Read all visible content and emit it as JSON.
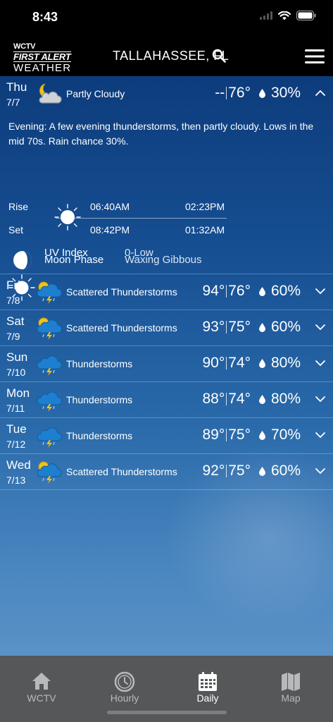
{
  "status": {
    "time": "8:43"
  },
  "header": {
    "logo_top": "WCTV",
    "logo_mid": "FIRST ALERT",
    "logo_bottom": "WEATHER",
    "city": "TALLAHASSEE, FL"
  },
  "today": {
    "day": "Thu",
    "date": "7/7",
    "condition": "Partly Cloudy",
    "high": "--",
    "low": "76°",
    "rain": "30%",
    "narrative_label": "Evening",
    "narrative_text": ": A few evening thunderstorms, then partly cloudy. Lows in the mid 70s. Rain chance 30%.",
    "rise_label": "Rise",
    "set_label": "Set",
    "sunrise": "06:40AM",
    "sunset": "08:42PM",
    "moonrise": "02:23PM",
    "moonset": "01:32AM",
    "moon_phase_label": "Moon Phase",
    "moon_phase_value": "Waxing Gibbous",
    "uv_label": "UV Index",
    "uv_value": "0-Low"
  },
  "days": [
    {
      "day": "Fri",
      "date": "7/8",
      "condition": "Scattered Thunderstorms",
      "icon": "scattered-thunderstorms-icon",
      "high": "94°",
      "low": "76°",
      "rain": "60%"
    },
    {
      "day": "Sat",
      "date": "7/9",
      "condition": "Scattered Thunderstorms",
      "icon": "scattered-thunderstorms-icon",
      "high": "93°",
      "low": "75°",
      "rain": "60%"
    },
    {
      "day": "Sun",
      "date": "7/10",
      "condition": "Thunderstorms",
      "icon": "thunderstorms-icon",
      "high": "90°",
      "low": "74°",
      "rain": "80%"
    },
    {
      "day": "Mon",
      "date": "7/11",
      "condition": "Thunderstorms",
      "icon": "thunderstorms-icon",
      "high": "88°",
      "low": "74°",
      "rain": "80%"
    },
    {
      "day": "Tue",
      "date": "7/12",
      "condition": "Thunderstorms",
      "icon": "thunderstorms-icon",
      "high": "89°",
      "low": "75°",
      "rain": "70%"
    },
    {
      "day": "Wed",
      "date": "7/13",
      "condition": "Scattered Thunderstorms",
      "icon": "scattered-thunderstorms-icon",
      "high": "92°",
      "low": "75°",
      "rain": "60%"
    }
  ],
  "tabs": [
    {
      "label": "WCTV",
      "icon": "home-icon",
      "active": false
    },
    {
      "label": "Hourly",
      "icon": "clock-icon",
      "active": false
    },
    {
      "label": "Daily",
      "icon": "calendar-icon",
      "active": true
    },
    {
      "label": "Map",
      "icon": "map-icon",
      "active": false
    }
  ],
  "colors": {
    "background_top": "#0d3c7c",
    "background_bottom": "#5b92c6",
    "tabbar": "#555759",
    "tab_inactive": "#b8b9bb"
  }
}
